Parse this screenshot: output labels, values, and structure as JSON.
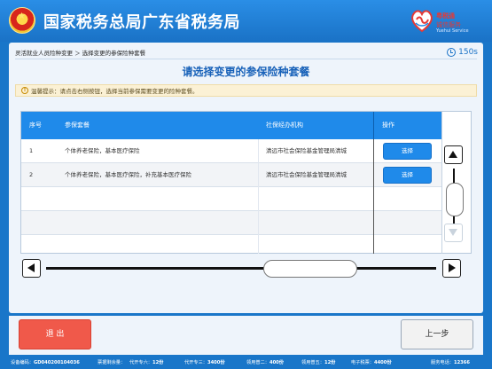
{
  "header": {
    "title": "国家税务总局广东省税务局",
    "service_logo_line1": "粤税通",
    "service_logo_line2": "诚信服务",
    "service_logo_line3": "Yuehui Service"
  },
  "breadcrumb": "灵活就业人员险种变更 ＞ 选择变更的参保险种套餐",
  "timer": "150s",
  "page_title": "请选择变更的参保险种套餐",
  "notice": "温馨提示：请点击右侧按钮，选择当前参保需要变更的险种套餐。",
  "table": {
    "headers": [
      "序号",
      "参保套餐",
      "社保经办机构",
      "操作"
    ],
    "rows": [
      {
        "index": "1",
        "package": "个体养老保险，基本医疗保险",
        "agency": "清远市社会保险基金管理局清城",
        "action": "选择"
      },
      {
        "index": "2",
        "package": "个体养老保险，基本医疗保险，补充基本医疗保险",
        "agency": "清远市社会保险基金管理局清城",
        "action": "选择"
      }
    ]
  },
  "buttons": {
    "exit": "退 出",
    "back": "上一步"
  },
  "status_bar": {
    "device_label": "设备编码：",
    "device_value": "GD040200104036",
    "stock_label": "票据剩余量：",
    "item1_label": "代开专六：",
    "item1_value": "12份",
    "item2_label": "代开专三：",
    "item2_value": "3400份",
    "item3_label": "领用普二：",
    "item3_value": "400份",
    "item4_label": "领用普五：",
    "item4_value": "12份",
    "item5_label": "电子税票：",
    "item5_value": "4400份",
    "phone_label": "服务电话：",
    "phone_value": "12366"
  },
  "colors": {
    "background": "#1976c9",
    "accent": "#1f8aea",
    "exit": "#f0594a"
  },
  "icons": [
    "emblem-icon",
    "heart-logo-icon",
    "clock-icon",
    "info-icon",
    "arrow-up-icon",
    "arrow-down-icon",
    "arrow-left-icon",
    "arrow-right-icon"
  ]
}
